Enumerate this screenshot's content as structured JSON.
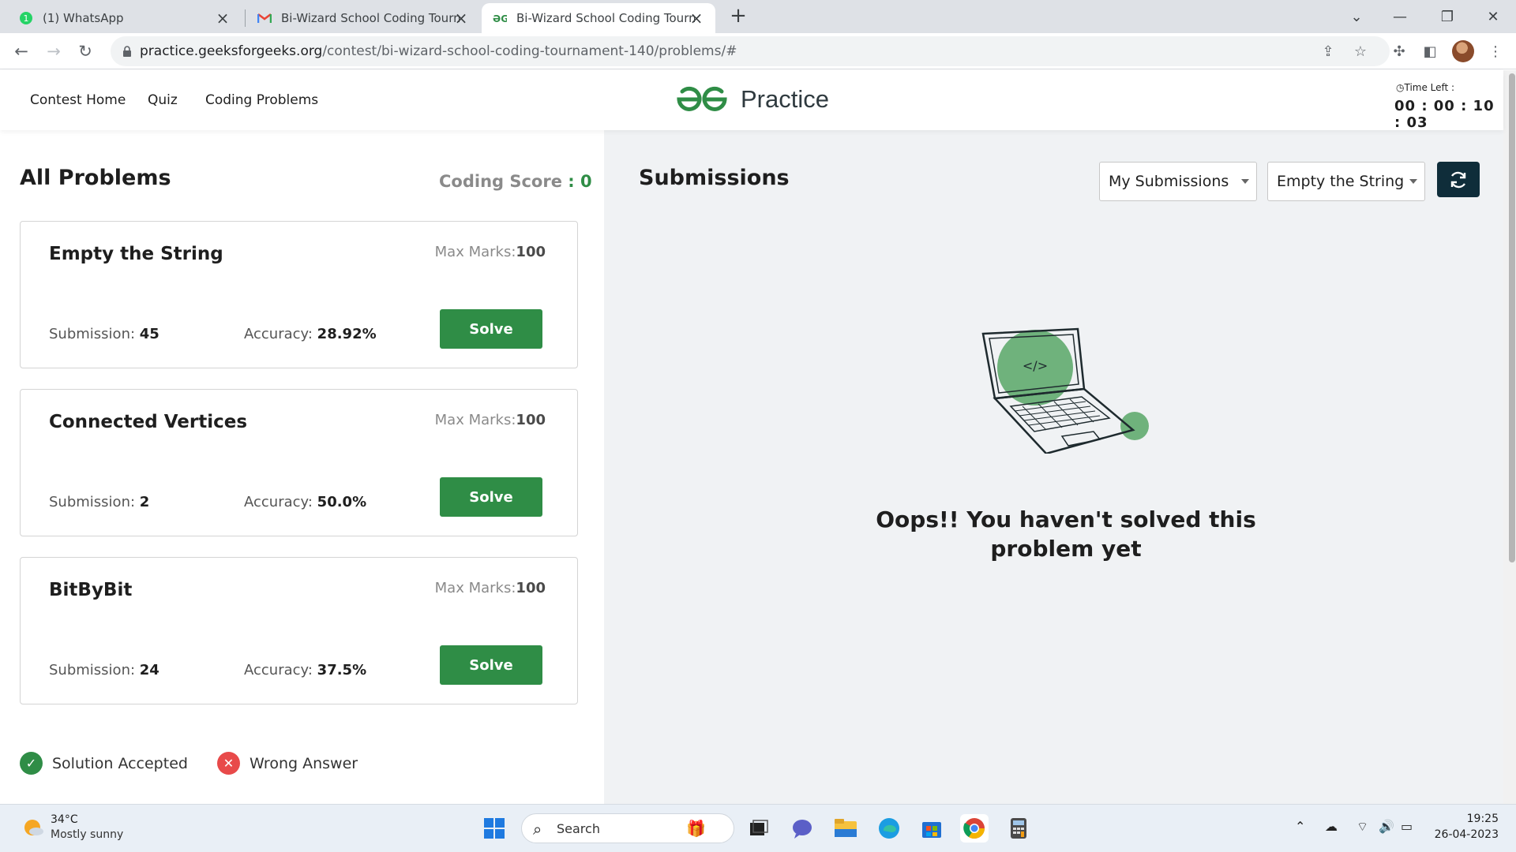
{
  "browser": {
    "tabs": [
      {
        "title": "(1) WhatsApp",
        "icon": "whatsapp-icon",
        "active": false
      },
      {
        "title": "Bi-Wizard School Coding Tournam",
        "icon": "gmail-icon",
        "active": false
      },
      {
        "title": "Bi-Wizard School Coding Tournam",
        "icon": "gfg-icon",
        "active": true
      }
    ],
    "url_host": "practice.geeksforgeeks.org",
    "url_path": "/contest/bi-wizard-school-coding-tournament-140/problems/#"
  },
  "topnav": {
    "links": [
      "Contest Home",
      "Quiz",
      "Coding Problems"
    ],
    "logo_text": "Practice",
    "time_left_label": "Time Left :",
    "time_left": "00 : 00 : 10 : 03"
  },
  "problems": {
    "heading": "All Problems",
    "score_label": "Coding Score",
    "score_value": ": 0",
    "max_marks_label": "Max Marks:",
    "submission_label": "Submission:",
    "accuracy_label": "Accuracy:",
    "solve_label": "Solve",
    "items": [
      {
        "name": "Empty the String",
        "max_marks": "100",
        "submissions": "45",
        "accuracy": "28.92%"
      },
      {
        "name": "Connected Vertices",
        "max_marks": "100",
        "submissions": "2",
        "accuracy": "50.0%"
      },
      {
        "name": "BitByBit",
        "max_marks": "100",
        "submissions": "24",
        "accuracy": "37.5%"
      }
    ]
  },
  "legend": {
    "accepted": "Solution Accepted",
    "wrong": "Wrong Answer"
  },
  "submissions": {
    "heading": "Submissions",
    "filter_selected": "My Submissions",
    "problem_selected": "Empty the String",
    "empty_message": "Oops!! You haven't solved this problem yet",
    "illustration_code": "</>"
  },
  "taskbar": {
    "temp": "34°C",
    "weather": "Mostly sunny",
    "search_label": "Search",
    "time": "19:25",
    "date": "26-04-2023"
  },
  "colors": {
    "brand_green": "#2f8d46",
    "wrong_red": "#e84a4a",
    "refresh_bg": "#0f2d3a"
  }
}
